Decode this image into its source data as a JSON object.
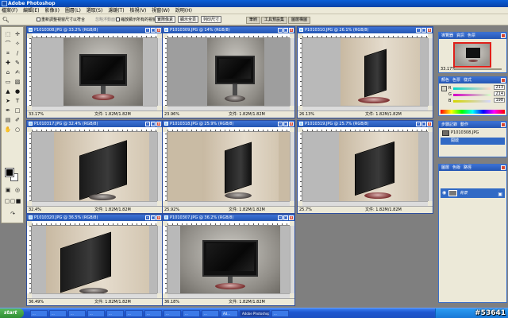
{
  "app": {
    "title": "Adobe Photoshop"
  },
  "menu": [
    "檔案(F)",
    "編輯(E)",
    "影像(I)",
    "圖層(L)",
    "選取(S)",
    "濾鏡(T)",
    "檢視(V)",
    "視窗(W)",
    "說明(H)"
  ],
  "options": {
    "check1": "重新調整視窗尺寸以符合",
    "check2": "忽略浮動面板",
    "check3": "縮放顯示所有的視窗",
    "btn_actual": "實際像素",
    "btn_fit": "顯示全頁",
    "btn_print": "列印尺寸",
    "well_tabs": [
      "筆刷",
      "工具預設集",
      "圖層構圖"
    ]
  },
  "documents": [
    {
      "title": "P1010308.JPG @ 33.2% (RGB/8)",
      "zoom": "33.17%",
      "file": "文件: 1.82M/1.82M",
      "view": "front"
    },
    {
      "title": "P1010309.JPG @ 14% (RGB/8)",
      "zoom": "23.96%",
      "file": "文件: 1.82M/1.82M",
      "view": "front"
    },
    {
      "title": "P1010310.JPG @ 26.1% (RGB/8)",
      "zoom": "26.13%",
      "file": "文件: 1.82M/1.82M",
      "view": "side"
    },
    {
      "title": "P1010317.JPG @ 32.4% (RGB/8)",
      "zoom": "32.4%",
      "file": "文件: 1.82M/1.82M",
      "view": "side"
    },
    {
      "title": "P1010318.JPG @ 25.9% (RGB/8)",
      "zoom": "25.92%",
      "file": "文件: 1.82M/1.82M",
      "view": "side"
    },
    {
      "title": "P1010319.JPG @ 25.7% (RGB/8)",
      "zoom": "25.7%",
      "file": "文件: 1.82M/1.82M",
      "view": "side"
    },
    {
      "title": "P1010320.JPG @ 36.5% (RGB/8)",
      "zoom": "36.49%",
      "file": "文件: 1.82M/1.82M",
      "view": "side"
    },
    {
      "title": "P1010307.JPG @ 36.2% (RGB/8)",
      "zoom": "36.18%",
      "file": "文件: 1.82M/1.82M",
      "view": "front"
    }
  ],
  "panels": {
    "navigator": {
      "tabs": [
        "導覽器",
        "資訊",
        "色票"
      ],
      "zoom": "33.17%"
    },
    "color": {
      "tabs": [
        "顏色",
        "色票",
        "樣式"
      ],
      "r": "213",
      "g": "214",
      "b": "198",
      "r_label": "R",
      "g_label": "G",
      "b_label": "B"
    },
    "history": {
      "tabs": [
        "步驟記錄",
        "動作"
      ],
      "items": [
        "P1010308.JPG",
        "開啟"
      ]
    },
    "layers": {
      "tabs": [
        "圖層",
        "色版",
        "路徑"
      ],
      "layer_name": "背景"
    }
  },
  "taskbar": {
    "start": "start",
    "items": [
      "...",
      "...",
      "...",
      "...",
      "...",
      "...",
      "...",
      "...",
      "...",
      "...",
      "Ad...",
      "Adobe Photoshop",
      "..."
    ],
    "watermark": "#53641"
  }
}
